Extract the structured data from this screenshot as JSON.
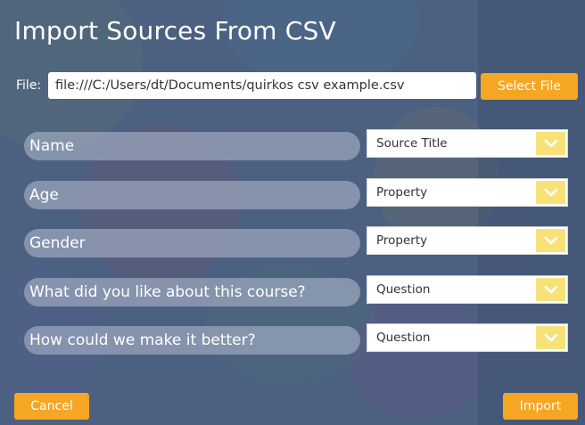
{
  "dialog": {
    "title": "Import Sources From CSV",
    "file_label": "File:",
    "file_value": "file:///C:/Users/dt/Documents/quirkos csv example.csv",
    "select_file_label": "Select File",
    "cancel_label": "Cancel",
    "import_label": "Import"
  },
  "rows": [
    {
      "label": "Name",
      "mapping": "Source Title"
    },
    {
      "label": "Age",
      "mapping": "Property"
    },
    {
      "label": "Gender",
      "mapping": "Property"
    },
    {
      "label": "What did you like about this course?",
      "mapping": "Question"
    },
    {
      "label": "How could we make it better?",
      "mapping": "Question"
    }
  ],
  "colors": {
    "accent": "#f5a623",
    "dropdown_arrow_bg": "#f7e27a",
    "overlay": "#5c6f8c"
  }
}
